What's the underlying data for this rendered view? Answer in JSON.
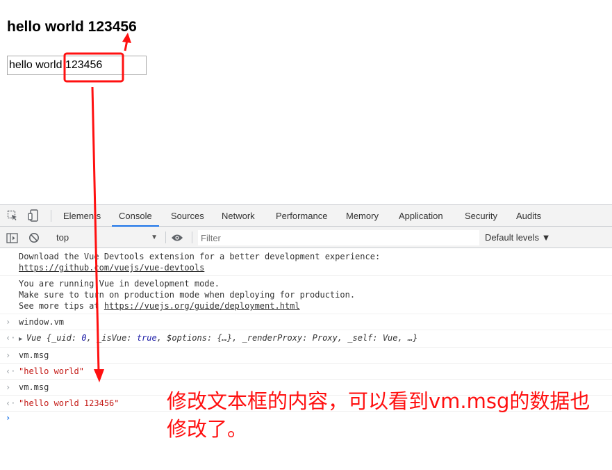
{
  "page": {
    "heading": "hello world 123456",
    "input_value": "hello world 123456"
  },
  "devtools": {
    "tabs": [
      {
        "label": "Elements"
      },
      {
        "label": "Console",
        "active": true
      },
      {
        "label": "Sources"
      },
      {
        "label": "Network"
      },
      {
        "label": "Performance"
      },
      {
        "label": "Memory"
      },
      {
        "label": "Application"
      },
      {
        "label": "Security"
      },
      {
        "label": "Audits"
      }
    ],
    "toolbar": {
      "context": "top",
      "filter_placeholder": "Filter",
      "levels": "Default levels ▼"
    },
    "console": {
      "devtools_msg_line1": "Download the Vue Devtools extension for a better development experience:",
      "devtools_link": "https://github.com/vuejs/vue-devtools",
      "dev_mode_line1": "You are running Vue in development mode.",
      "dev_mode_line2": "Make sure to turn on production mode when deploying for production.",
      "dev_mode_line3_prefix": "See more tips at ",
      "dev_mode_link": "https://vuejs.org/guide/deployment.html",
      "cmd1": "window.vm",
      "result1_prefix": "Vue {",
      "result1_uid_key": "_uid: ",
      "result1_uid_val": "0",
      "result1_isvue_key": ", _isVue: ",
      "result1_isvue_val": "true",
      "result1_rest": ", $options: {…}, _renderProxy: Proxy, _self: Vue, …}",
      "cmd2": "vm.msg",
      "result2": "\"hello world\"",
      "cmd3": "vm.msg",
      "result3": "\"hello world 123456\""
    }
  },
  "annotation": {
    "text": "修改文本框的内容，可以看到vm.msg的数据也修改了。",
    "color": "#ff1010"
  },
  "colors": {
    "accent": "#1a73e8",
    "string": "#c41a16",
    "keyword": "#1a1aa6",
    "annotation_red": "#ff1010"
  }
}
